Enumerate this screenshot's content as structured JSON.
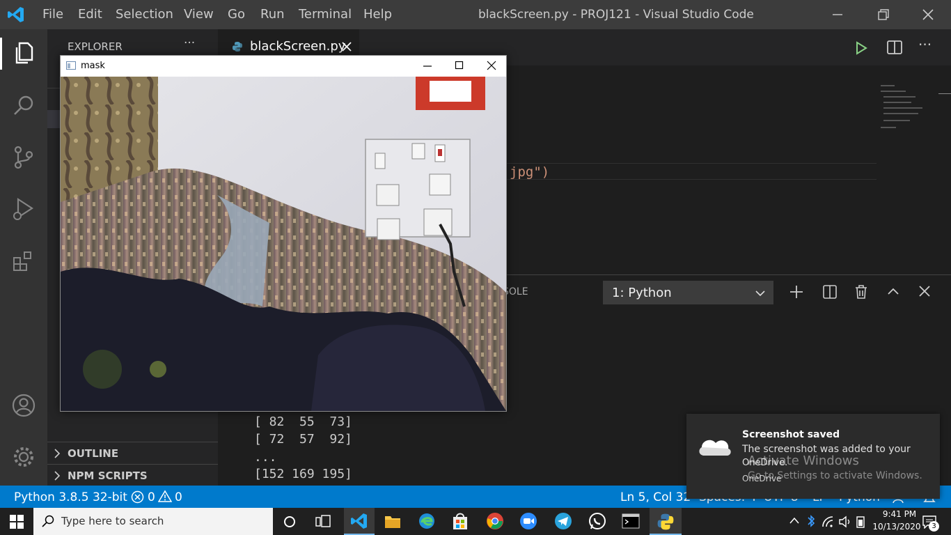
{
  "titlebar": {
    "menus": [
      "File",
      "Edit",
      "Selection",
      "View",
      "Go",
      "Run",
      "Terminal",
      "Help"
    ],
    "title": "blackScreen.py - PROJ121 - Visual Studio Code"
  },
  "sidebar": {
    "header": "EXPLORER",
    "more": "···",
    "outline": "OUTLINE",
    "npm_scripts": "NPM SCRIPTS"
  },
  "editor": {
    "tab_label": "blackScreen.py",
    "visible_code": "jpg\")"
  },
  "panel": {
    "tab_partial": "SOLE",
    "terminal_select": "1: Python",
    "lines": [
      "[ 82  55  73]",
      "[ 72  57  92]",
      "...",
      "[152 169 195]"
    ]
  },
  "mask_window": {
    "title": "mask"
  },
  "toast": {
    "title": "Screenshot saved",
    "body": "The screenshot was added to your",
    "source1": "OneDrive.",
    "source2": "OneDrive",
    "watermark1": "Activate Windows",
    "watermark2": "Go to Settings to activate Windows."
  },
  "statusbar": {
    "interpreter": "Python 3.8.5 32-bit",
    "errors": "0",
    "warnings": "0",
    "position": "Ln 5, Col 32",
    "spaces": "Spaces: 4",
    "encoding": "UTF-8",
    "eol": "LF",
    "language": "Python"
  },
  "taskbar": {
    "search_placeholder": "Type here to search",
    "time": "9:41 PM",
    "date": "10/13/2020",
    "notifications": "3"
  },
  "colors": {
    "accent": "#007acc",
    "titlebar": "#3c3c3c",
    "activitybar": "#333333",
    "sidebar": "#252526",
    "editor": "#1e1e1e",
    "run_green": "#89d185"
  }
}
